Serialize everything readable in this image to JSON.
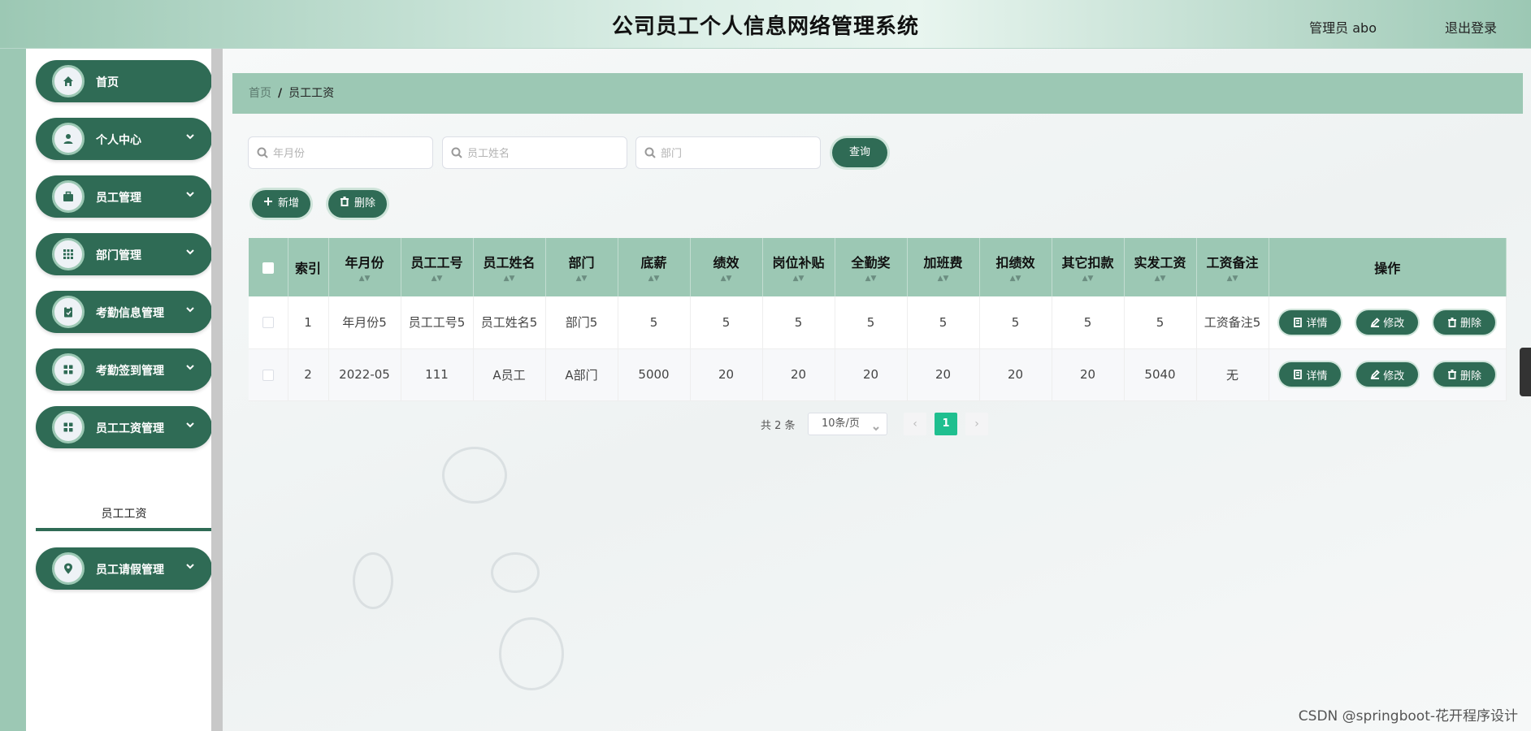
{
  "header": {
    "title": "公司员工个人信息网络管理系统",
    "user": "管理员 abo",
    "logout": "退出登录"
  },
  "sidebar": {
    "items": [
      {
        "label": "首页",
        "icon": "home-icon"
      },
      {
        "label": "个人中心",
        "icon": "user-icon"
      },
      {
        "label": "员工管理",
        "icon": "briefcase-icon"
      },
      {
        "label": "部门管理",
        "icon": "grid-icon"
      },
      {
        "label": "考勤信息管理",
        "icon": "clipboard-icon"
      },
      {
        "label": "考勤签到管理",
        "icon": "apps-icon"
      },
      {
        "label": "员工工资管理",
        "icon": "apps-icon"
      },
      {
        "label": "员工请假管理",
        "icon": "location-icon"
      }
    ],
    "submenu_active": "员工工资"
  },
  "breadcrumb": {
    "home": "首页",
    "separator": "/",
    "current": "员工工资"
  },
  "search": {
    "month_placeholder": "年月份",
    "name_placeholder": "员工姓名",
    "dept_placeholder": "部门",
    "query_label": "查询"
  },
  "actions": {
    "add_label": "新增",
    "delete_label": "删除"
  },
  "table": {
    "columns": [
      "索引",
      "年月份",
      "员工工号",
      "员工姓名",
      "部门",
      "底薪",
      "绩效",
      "岗位补贴",
      "全勤奖",
      "加班费",
      "扣绩效",
      "其它扣款",
      "实发工资",
      "工资备注",
      "操作"
    ],
    "rows": [
      [
        "1",
        "年月份5",
        "员工工号5",
        "员工姓名5",
        "部门5",
        "5",
        "5",
        "5",
        "5",
        "5",
        "5",
        "5",
        "5",
        "工资备注5"
      ],
      [
        "2",
        "2022-05",
        "111",
        "A员工",
        "A部门",
        "5000",
        "20",
        "20",
        "20",
        "20",
        "20",
        "20",
        "5040",
        "无"
      ]
    ],
    "op_detail": "详情",
    "op_edit": "修改",
    "op_delete": "删除"
  },
  "pagination": {
    "total": "共 2 条",
    "page_size": "10条/页",
    "current_page": "1",
    "prev": "‹",
    "next": "›"
  },
  "watermark": "CSDN @springboot-花开程序设计",
  "colors": {
    "primary": "#2f6b55",
    "light": "#9cc8b4",
    "active_page": "#1fbf8f"
  }
}
